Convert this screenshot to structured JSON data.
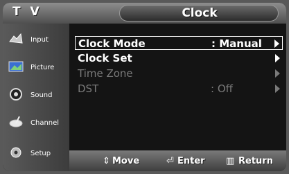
{
  "header": {
    "source": "T V",
    "title": "Clock"
  },
  "sidebar": {
    "items": [
      {
        "label": "Input",
        "icon": "input-icon"
      },
      {
        "label": "Picture",
        "icon": "picture-icon"
      },
      {
        "label": "Sound",
        "icon": "sound-icon"
      },
      {
        "label": "Channel",
        "icon": "channel-icon"
      },
      {
        "label": "Setup",
        "icon": "setup-icon"
      }
    ]
  },
  "menu": {
    "rows": [
      {
        "label": "Clock Mode",
        "value": ": Manual"
      },
      {
        "label": "Clock Set",
        "value": ""
      },
      {
        "label": "Time Zone",
        "value": ""
      },
      {
        "label": "DST",
        "value": ": Off"
      }
    ]
  },
  "footer": {
    "move": "Move",
    "enter": "Enter",
    "return": "Return"
  }
}
